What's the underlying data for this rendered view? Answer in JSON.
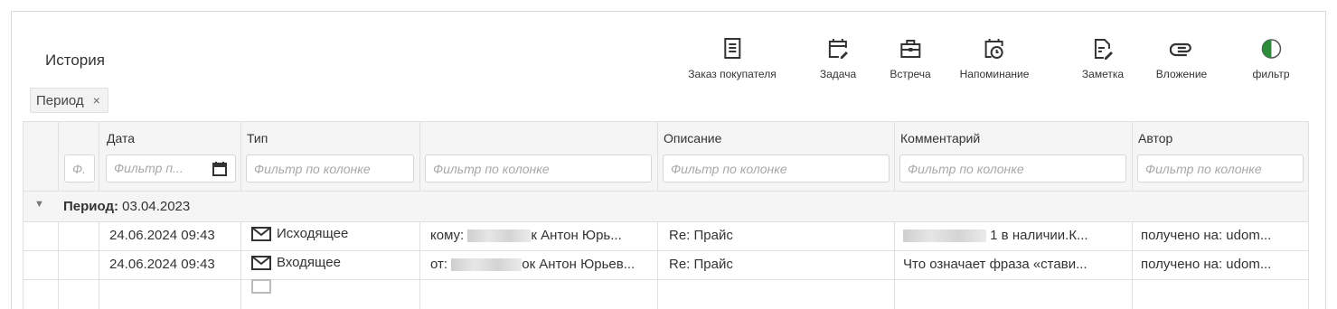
{
  "header": {
    "title": "История"
  },
  "toolbar": {
    "items": [
      {
        "label": "Заказ покупателя",
        "icon": "document-list-icon"
      },
      {
        "label": "Задача",
        "icon": "calendar-edit-icon"
      },
      {
        "label": "Встреча",
        "icon": "briefcase-icon"
      },
      {
        "label": "Напоминание",
        "icon": "calendar-clock-icon"
      },
      {
        "label": "Заметка",
        "icon": "note-edit-icon"
      },
      {
        "label": "Вложение",
        "icon": "paperclip-icon"
      },
      {
        "label": "фильтр",
        "icon": "toggle-icon",
        "toggle_on": true
      }
    ]
  },
  "chips": {
    "period": "Период",
    "remove": "×"
  },
  "table": {
    "columns": {
      "date": "Дата",
      "type": "Тип",
      "party": "",
      "description": "Описание",
      "comment": "Комментарий",
      "author": "Автор"
    },
    "filters": {
      "num": "Ф.",
      "date": "Фильтр п...",
      "type": "Фильтр по колонке",
      "party": "Фильтр по колонке",
      "description": "Фильтр по колонке",
      "comment": "Фильтр по колонке",
      "author": "Фильтр по колонке"
    },
    "group": {
      "label": "Период:",
      "value": "03.04.2023"
    },
    "rows": [
      {
        "date": "24.06.2024 09:43",
        "type": "Исходящее",
        "party_prefix": "кому:",
        "party_suffix": "к Антон Юрь...",
        "description": "Re: Прайс",
        "comment_suffix": "1  в наличии.К...",
        "author": "получено на: udom..."
      },
      {
        "date": "24.06.2024 09:43",
        "type": "Входящее",
        "party_prefix": "от:",
        "party_suffix": "ок Антон Юрьев...",
        "description": "Re: Прайс",
        "comment_suffix": "Что означает фраза «стави...",
        "author": "получено на: udom..."
      }
    ]
  },
  "colors": {
    "accent_green": "#2e8b3a",
    "header_bg": "#f5f5f5",
    "border": "#e0e0e0"
  }
}
